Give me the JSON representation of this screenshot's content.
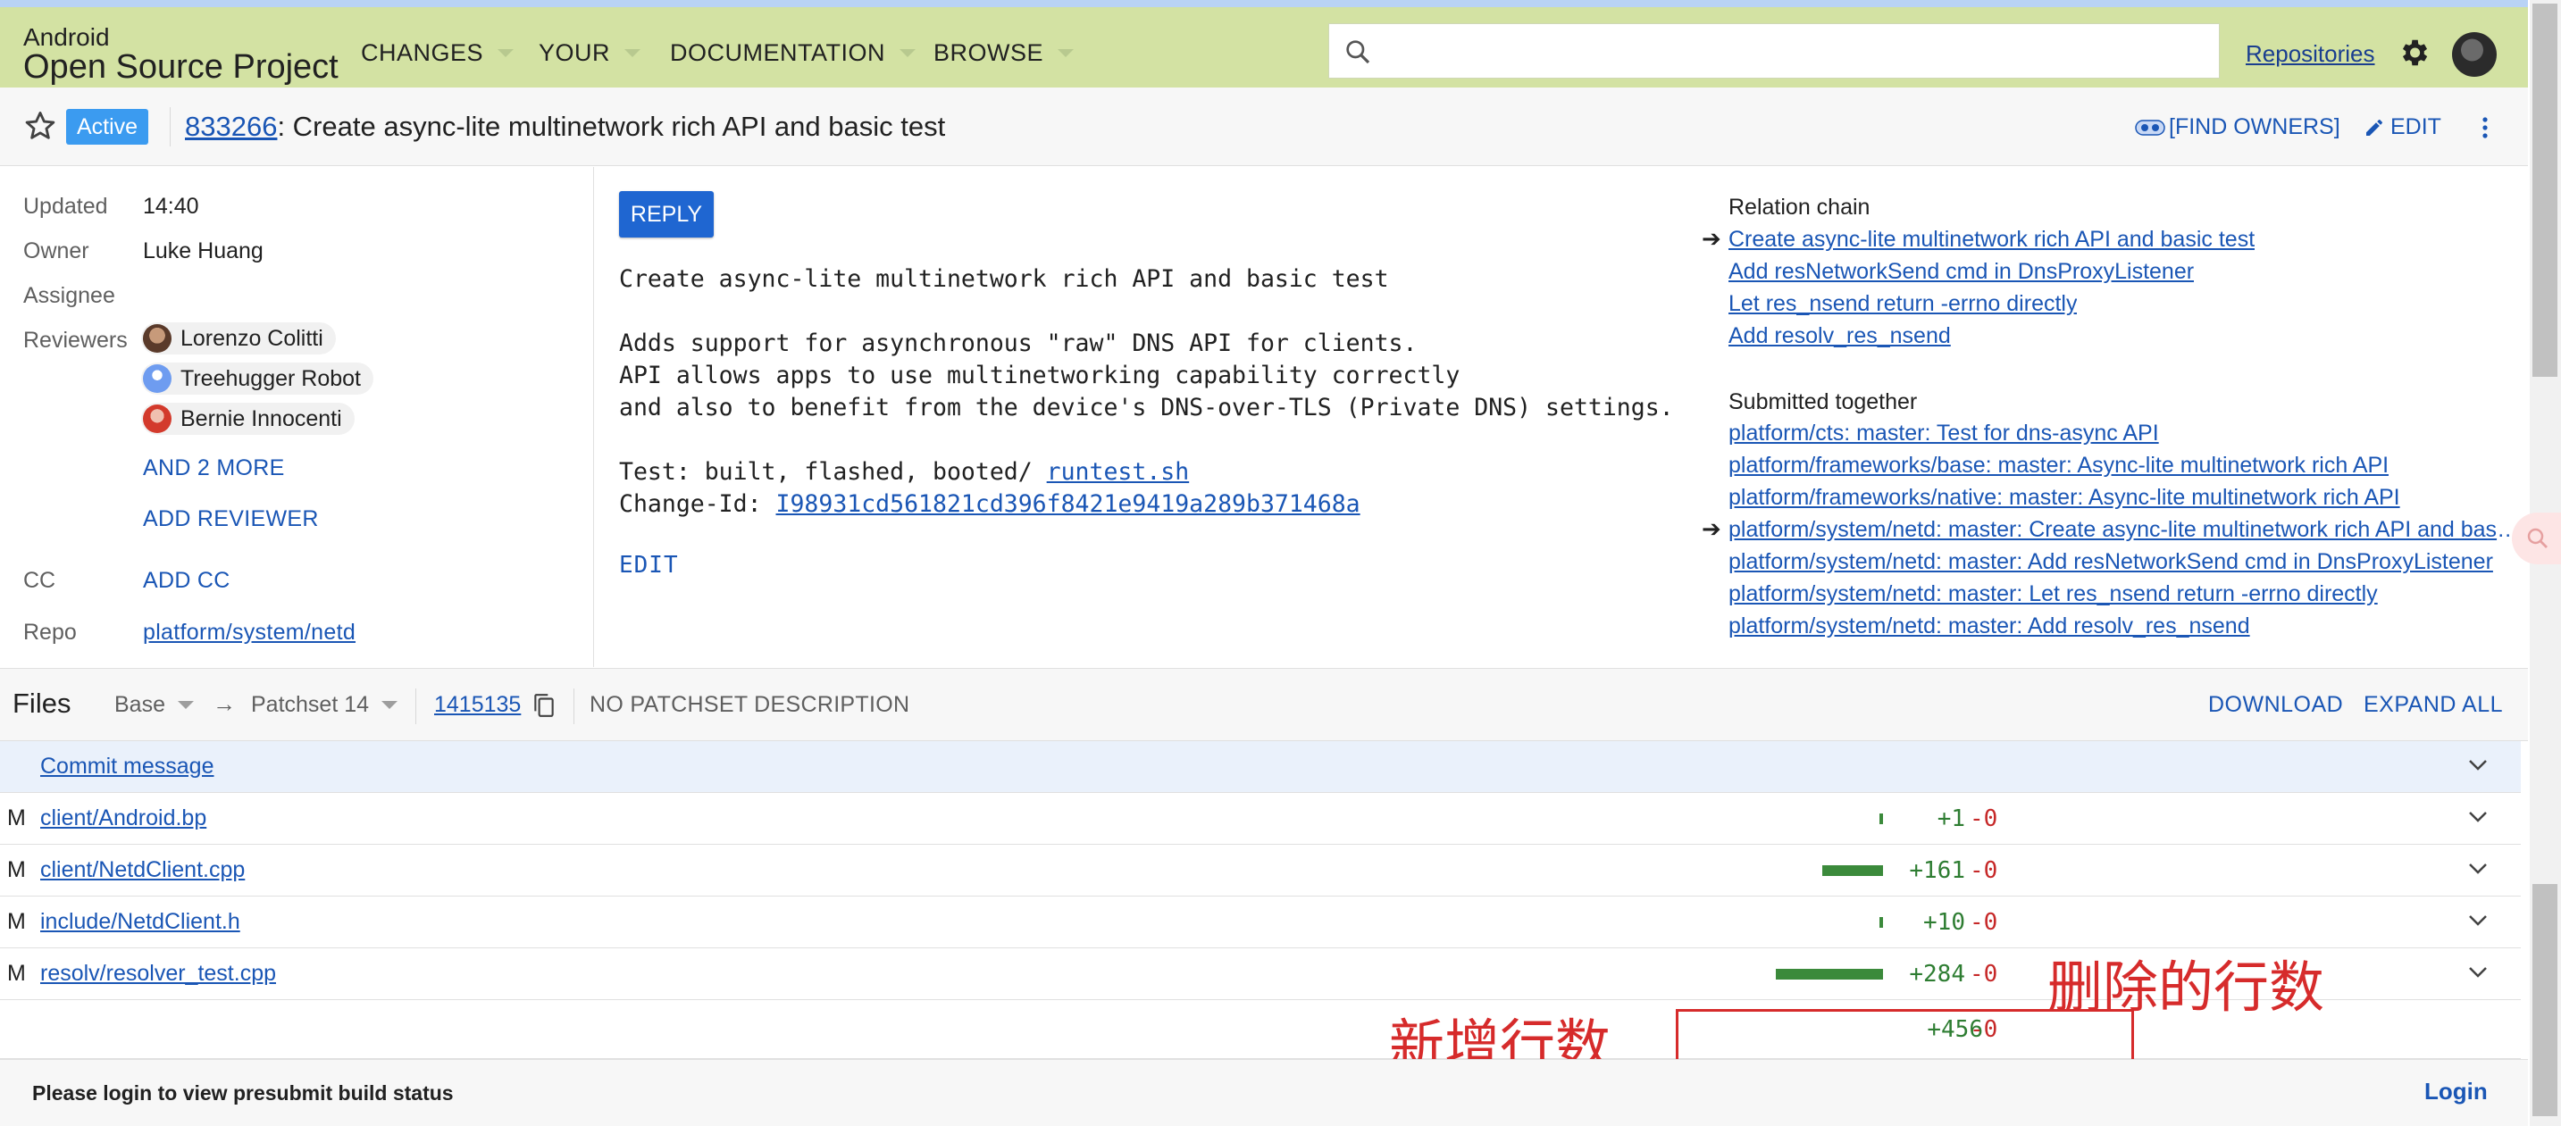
{
  "header": {
    "brand_small": "Android",
    "brand_big": "Open Source Project",
    "nav": [
      "CHANGES",
      "YOUR",
      "DOCUMENTATION",
      "BROWSE"
    ],
    "search_placeholder": "",
    "repositories": "Repositories",
    "icons": {
      "search": "search-icon",
      "settings": "gear-icon",
      "account": "avatar"
    }
  },
  "change": {
    "status": "Active",
    "number": "833266",
    "title": ": Create async-lite multinetwork rich API and basic test",
    "find_owners": "[FIND OWNERS]",
    "edit": "EDIT"
  },
  "info": {
    "updated_label": "Updated",
    "updated_value": "14:40",
    "owner_label": "Owner",
    "owner_value": "Luke Huang",
    "assignee_label": "Assignee",
    "reviewers_label": "Reviewers",
    "reviewers": [
      "Lorenzo Colitti",
      "Treehugger Robot",
      "Bernie Innocenti"
    ],
    "and_more": "AND 2 MORE",
    "add_reviewer": "ADD REVIEWER",
    "cc_label": "CC",
    "add_cc": "ADD CC",
    "repo_label": "Repo",
    "repo_value": "platform/system/netd"
  },
  "message": {
    "reply": "REPLY",
    "lines": [
      "Create async-lite multinetwork rich API and basic test",
      "",
      "Adds support for asynchronous \"raw\" DNS API for clients.",
      "API allows apps to use multinetworking capability correctly",
      "and also to benefit from the device's DNS-over-TLS (Private DNS) settings.",
      "",
      "Test: built, flashed, booted/ "
    ],
    "test_link": "runtest.sh",
    "change_id_label": "Change-Id: ",
    "change_id": "I98931cd561821cd396f8421e9419a289b371468a",
    "edit": "EDIT"
  },
  "relation": {
    "chain_title": "Relation chain",
    "chain": [
      "Create async-lite multinetwork rich API and basic test",
      "Add resNetworkSend cmd in DnsProxyListener",
      "Let res_nsend return -errno directly",
      "Add resolv_res_nsend"
    ],
    "together_title": "Submitted together",
    "together": [
      "platform/cts: master: Test for dns-async API",
      "platform/frameworks/base: master: Async-lite multinetwork rich API",
      "platform/frameworks/native: master: Async-lite multinetwork rich API",
      "platform/system/netd: master: Create async-lite multinetwork rich API and basic test",
      "platform/system/netd: master: Add resNetworkSend cmd in DnsProxyListener",
      "platform/system/netd: master: Let res_nsend return -errno directly",
      "platform/system/netd: master: Add resolv_res_nsend"
    ],
    "arrow": "➔"
  },
  "files": {
    "title": "Files",
    "base": "Base",
    "arrow": "→",
    "patchset": "Patchset 14",
    "patchset_id": "1415135",
    "patchset_desc": "NO PATCHSET DESCRIPTION",
    "download": "DOWNLOAD",
    "expand_all": "EXPAND ALL",
    "commit_message": "Commit message",
    "rows": [
      {
        "status": "M",
        "name": "client/Android.bp",
        "added": "+1",
        "deleted": "-0",
        "added_count": 1
      },
      {
        "status": "M",
        "name": "client/NetdClient.cpp",
        "added": "+161",
        "deleted": "-0",
        "added_count": 161
      },
      {
        "status": "M",
        "name": "include/NetdClient.h",
        "added": "+10",
        "deleted": "-0",
        "added_count": 10
      },
      {
        "status": "M",
        "name": "resolv/resolver_test.cpp",
        "added": "+284",
        "deleted": "-0",
        "added_count": 284
      }
    ],
    "total_added": "+456",
    "total_deleted": "-0"
  },
  "annotations": {
    "added": "新增行数",
    "deleted": "删除的行数"
  },
  "footer": {
    "message": "Please login to view presubmit build status",
    "login": "Login"
  },
  "colors": {
    "header_bg": "#d3e2a3",
    "link": "#1a56b5",
    "status_active": "#3b9bf0",
    "added": "#2e7d32",
    "deleted": "#c62828",
    "annotation": "#d62b2b"
  }
}
